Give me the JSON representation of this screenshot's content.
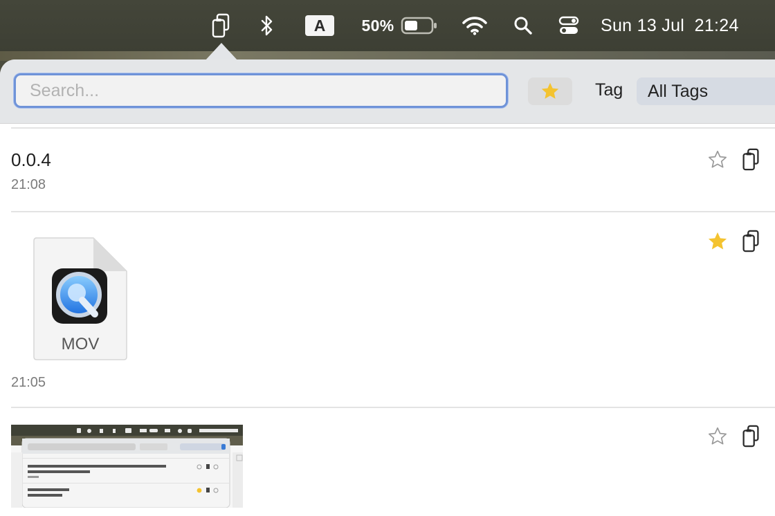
{
  "menubar": {
    "keyboard_indicator": "A",
    "battery_percent": "50%",
    "battery_level": 0.5,
    "datetime": "Sun 13 Jul  21:24",
    "icons": [
      "clipboard-app-icon",
      "bluetooth-icon",
      "keyboard-input-icon",
      "battery-icon",
      "wifi-icon",
      "spotlight-search-icon",
      "control-center-icon"
    ]
  },
  "toolbar": {
    "search_placeholder": "Search...",
    "search_value": "",
    "favorites_filter_icon": "star-icon",
    "tag_label": "Tag",
    "tag_selected": "All Tags"
  },
  "items": [
    {
      "title": "0.0.4",
      "time": "21:08",
      "favorite": false,
      "type": "text"
    },
    {
      "file_type": "MOV",
      "time": "21:05",
      "favorite": true,
      "type": "file"
    },
    {
      "type": "image",
      "favorite": false
    }
  ],
  "colors": {
    "accent_focus": "#6f93d8",
    "favorite_star": "#f4c330",
    "menubar_bg": "#414337"
  }
}
